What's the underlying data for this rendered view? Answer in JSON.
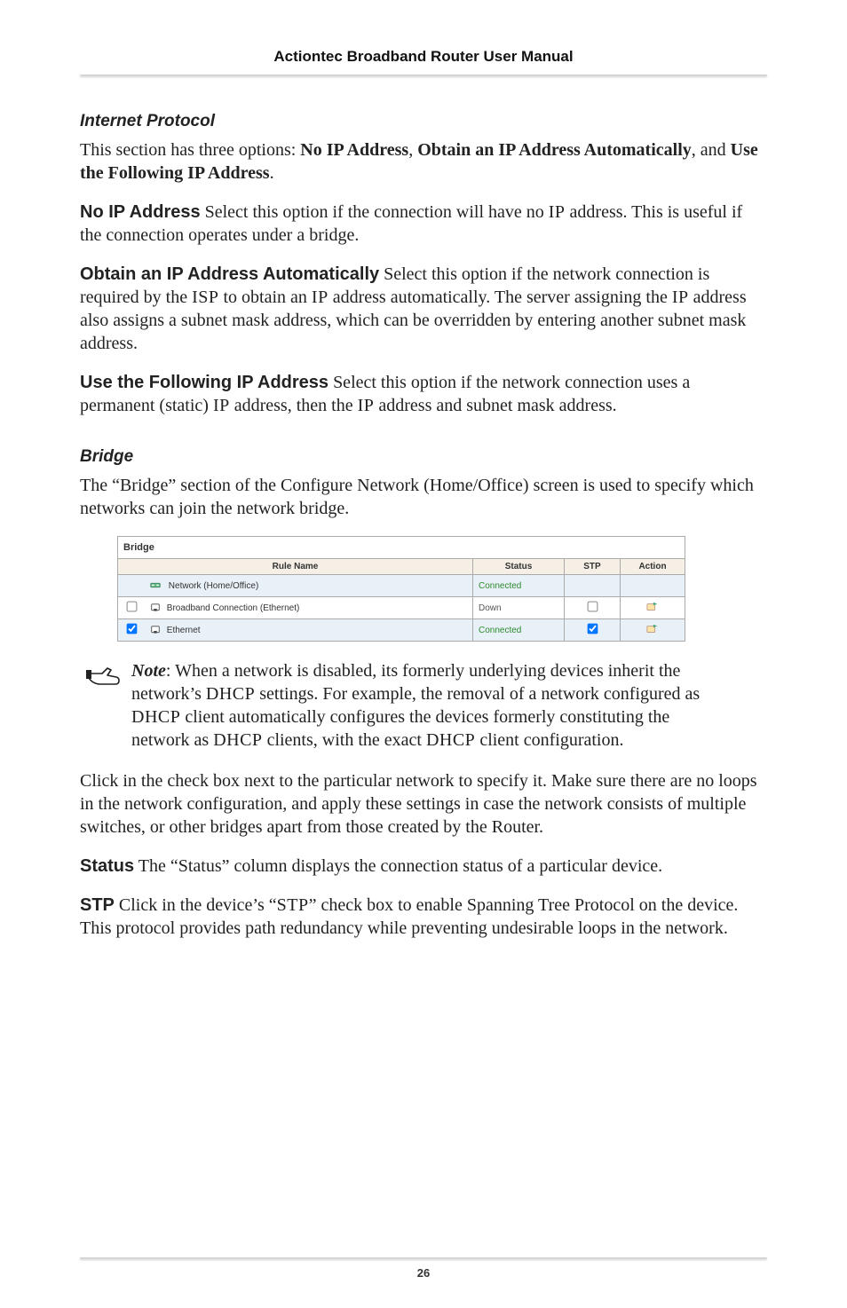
{
  "header": {
    "title": "Actiontec Broadband Router User Manual"
  },
  "footer": {
    "page_number": "26"
  },
  "sections": {
    "internet_protocol": {
      "heading": "Internet Protocol",
      "intro_pre": "This section has three options: ",
      "opt1": "No IP Address",
      "sep1": ", ",
      "opt2": "Obtain an IP Address Automatically",
      "sep2": ", and ",
      "opt3": "Use the Following IP Address",
      "intro_post": ".",
      "no_ip": {
        "label": "No IP Address",
        "text_a": "  Select this option if the connection will have no ",
        "sc1": "IP",
        "text_b": " address. This is useful if the connection operates under a bridge."
      },
      "obtain": {
        "label": "Obtain an IP Address Automatically",
        "text_a": "  Select this option if the network connection is required by the ",
        "sc1": "ISP",
        "text_b": " to obtain an ",
        "sc2": "IP",
        "text_c": " address automatically. The server assigning the ",
        "sc3": "IP",
        "text_d": " address also assigns a subnet mask address, which can be overridden by entering another subnet mask address."
      },
      "use_following": {
        "label": "Use the Following IP Address",
        "text_a": "  Select this option if the network connection uses a permanent (static) ",
        "sc1": "IP",
        "text_b": " address, then the ",
        "sc2": "IP",
        "text_c": " address and subnet mask address."
      }
    },
    "bridge": {
      "heading": "Bridge",
      "intro": "The “Bridge” section of the Configure Network (Home/Office) screen is used to specify which networks can join the network bridge.",
      "table": {
        "title": "Bridge",
        "headers": {
          "rule": "Rule Name",
          "status": "Status",
          "stp": "STP",
          "action": "Action"
        },
        "rows": [
          {
            "checkbox": null,
            "name": "Network (Home/Office)",
            "status": "Connected",
            "status_class": "status-green",
            "stp": null,
            "action": false
          },
          {
            "checkbox": false,
            "name": "Broadband Connection (Ethernet)",
            "status": "Down",
            "status_class": "status-gray",
            "stp": false,
            "action": true
          },
          {
            "checkbox": true,
            "name": "Ethernet",
            "status": "Connected",
            "status_class": "status-green",
            "stp": true,
            "action": true
          }
        ]
      },
      "note": {
        "label": "Note",
        "text_a": ": When a network is disabled, its formerly underlying devices inherit the network’s ",
        "sc1": "DHCP",
        "text_b": " settings. For example, the removal of a network configured as ",
        "sc2": "DHCP",
        "text_c": " client automatically configures the devices formerly constituting the network as ",
        "sc3": "DHCP",
        "text_d": " clients, with the exact ",
        "sc4": "DHCP",
        "text_e": " client configuration."
      },
      "click_text": "Click in the check box next to the particular network to specify it. Make sure there are no loops in the network configuration, and apply these settings in case the network consists of multiple switches, or other bridges apart from those created by the Router.",
      "status": {
        "label": "Status",
        "text": "  The “Status” column displays the connection status of a particular device."
      },
      "stp": {
        "label": "STP",
        "text_a": "  Click in the device’s “",
        "sc1": "STP",
        "text_b": "” check box to enable Spanning Tree Protocol on the device. This protocol provides path redundancy while preventing undesirable loops in the network."
      }
    }
  }
}
